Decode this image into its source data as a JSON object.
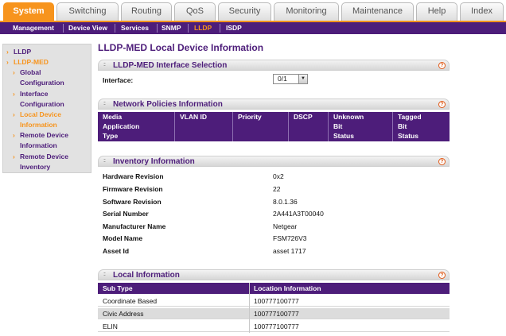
{
  "tabs": [
    "System",
    "Switching",
    "Routing",
    "QoS",
    "Security",
    "Monitoring",
    "Maintenance",
    "Help",
    "Index"
  ],
  "submenu": [
    "Management",
    "Device View",
    "Services",
    "SNMP",
    "LLDP",
    "ISDP"
  ],
  "sidebar": {
    "lldp": "LLDP",
    "lldp_med": "LLDP-MED",
    "items": [
      {
        "line1": "Global",
        "line2": "Configuration"
      },
      {
        "line1": "Interface",
        "line2": "Configuration"
      },
      {
        "line1": "Local Device",
        "line2": "Information"
      },
      {
        "line1": "Remote Device",
        "line2": "Information"
      },
      {
        "line1": "Remote Device",
        "line2": "Inventory"
      }
    ]
  },
  "page_title": "LLDP-MED Local Device Information",
  "interface_panel": {
    "title": "LLDP-MED Interface Selection",
    "label": "Interface:",
    "value": "0/1"
  },
  "network_panel": {
    "title": "Network Policies Information",
    "columns": [
      [
        "Media",
        "Application",
        "Type"
      ],
      [
        "VLAN ID"
      ],
      [
        "Priority"
      ],
      [
        "DSCP"
      ],
      [
        "Unknown",
        "Bit",
        "Status"
      ],
      [
        "Tagged",
        "Bit",
        "Status"
      ]
    ]
  },
  "inventory_panel": {
    "title": "Inventory Information",
    "rows": [
      {
        "label": "Hardware Revision",
        "value": "0x2"
      },
      {
        "label": "Firmware Revision",
        "value": "22"
      },
      {
        "label": "Software Revision",
        "value": "8.0.1.36"
      },
      {
        "label": "Serial Number",
        "value": "2A441A3T00040"
      },
      {
        "label": "Manufacturer Name",
        "value": "Netgear"
      },
      {
        "label": "Model Name",
        "value": "FSM726V3"
      },
      {
        "label": "Asset Id",
        "value": "asset 1717"
      }
    ]
  },
  "local_panel": {
    "title": "Local Information",
    "headers": [
      "Sub Type",
      "Location Information"
    ],
    "rows": [
      {
        "sub_type": "Coordinate Based",
        "location": "100777100777"
      },
      {
        "sub_type": "Civic Address",
        "location": "100777100777"
      },
      {
        "sub_type": "ELIN",
        "location": "100777100777"
      }
    ]
  },
  "help_glyph": "?",
  "colors": {
    "accent": "#f7941d",
    "brand": "#4d1d7a"
  }
}
